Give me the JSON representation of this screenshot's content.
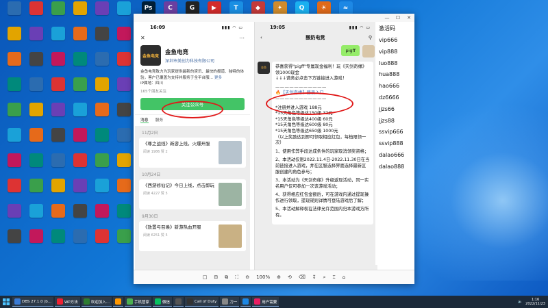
{
  "desktop": {
    "icons": [
      {
        "label": "Adobe Photoshop",
        "glyph": "Ps",
        "color": "#001e36"
      },
      {
        "label": "Visual C++",
        "glyph": "C",
        "color": "#6b3fa0"
      },
      {
        "label": "",
        "glyph": "G",
        "color": "#222222"
      },
      {
        "label": "",
        "glyph": "▶",
        "color": "#d22b2b"
      },
      {
        "label": "",
        "glyph": "T",
        "color": "#1a8fe3"
      },
      {
        "label": "",
        "glyph": "◆",
        "color": "#c43a3a"
      },
      {
        "label": "",
        "glyph": "✦",
        "color": "#d08b2c"
      },
      {
        "label": "",
        "glyph": "Q",
        "color": "#1ab0f0"
      },
      {
        "label": "",
        "glyph": "☀",
        "color": "#e06a1a"
      },
      {
        "label": "",
        "glyph": "≈",
        "color": "#1d88e5"
      }
    ]
  },
  "window": {
    "minimize": "—",
    "maximize": "☐",
    "close": "✕"
  },
  "phone1": {
    "time": "16:09",
    "signal": "▮▮▮ ◠ ▭",
    "account_name": "金鱼电竞",
    "company": "深圳市美创力科技有限公司",
    "logo_text": "金鱼电竞",
    "description": "金鱼电竞致力为玩家提供最新的资讯、最快的报道、独特的体验，客户已覆盖为支持并服务于全平台服...",
    "more": "更多",
    "ip": "IP属地：四川",
    "friends": "165个朋友关注",
    "follow_label": "关注公众号",
    "tabs": [
      "消息",
      "服务"
    ],
    "messages": [
      {
        "date": "11月2日",
        "title": "《尊之战线》新游上线，火爆开服",
        "meta": "阅读 1986  赞 2",
        "thumb": "#b7c4ce"
      },
      {
        "date": "10月24日",
        "title": "《西游修仙记》今日上线，点击即玩",
        "meta": "阅读 4227  赞 5",
        "thumb": "#9cb4a3"
      },
      {
        "date": "9月30日",
        "title": "《放置与召唤》新游热血开服",
        "meta": "阅读 6251  赞 5",
        "thumb": "#c9b184"
      }
    ]
  },
  "phone2": {
    "time": "19:05",
    "title": "酸奶电竞",
    "user_message": "pigff",
    "reply": {
      "intro": "恭喜获得\"pigff\"专属现金福利！玩《天剑奇缘》领1000现金",
      "arrow_line": "↓↓↓请务必点击下方链接进入游戏！",
      "dashes": "———————————",
      "link_line": "🔥【天剑奇缘】登录入口",
      "rules_title": "*注册并进入游戏 188元",
      "rules": [
        "*15天角色等级达150级 32元",
        "*15天角色等级达400级 60元",
        "*15天角色等级达600级 80元",
        "*15天角色等级达650级 1000元"
      ],
      "rules_note": "（以上奖励达到即可领取相应红包，每档限领一次）",
      "terms": [
        "1、使用作弊手段达成条件的玩家取消领奖资格；",
        "2、本活动仅限2022.11.4日-2022.11.30日在当前链接进入游戏，并在区服选择界面选择最新区服创建的角色参与；",
        "3、本活动为《天剑奇缘》升级返现活动，同一实名用户仅可参加一次该游戏活动；",
        "4、获得相应红包金额后，可在游戏内通过提现操作进行领取，提现规则详情可登陆游戏后了解；",
        "5、本活动解释权在法律允许范围内归本游戏方所有。"
      ]
    }
  },
  "viewer_toolbar": {
    "zoom": "100%",
    "icons": [
      "□",
      "⊟",
      "⧉",
      "⛶",
      "⊖",
      "⊕",
      "⟲",
      "⌫",
      "↧",
      "⌕",
      "⌶",
      "⌂"
    ]
  },
  "codes": {
    "title": "激活码",
    "items": [
      "vip666",
      "vip888",
      "luo888",
      "hua888",
      "hao666",
      "dz6666",
      "jjzs66",
      "jjzs88",
      "ssvip666",
      "ssvip888",
      "dalao666",
      "dalao888"
    ]
  },
  "taskbar": {
    "items": [
      "DBS 27.1.0 |b...",
      "WP方法",
      "欢迎加入...",
      "",
      "手机管家",
      "微信",
      "",
      "Call of Duty",
      "刀一",
      "",
      "用户需要"
    ],
    "time": "1:16",
    "date": "2022/11/23"
  }
}
